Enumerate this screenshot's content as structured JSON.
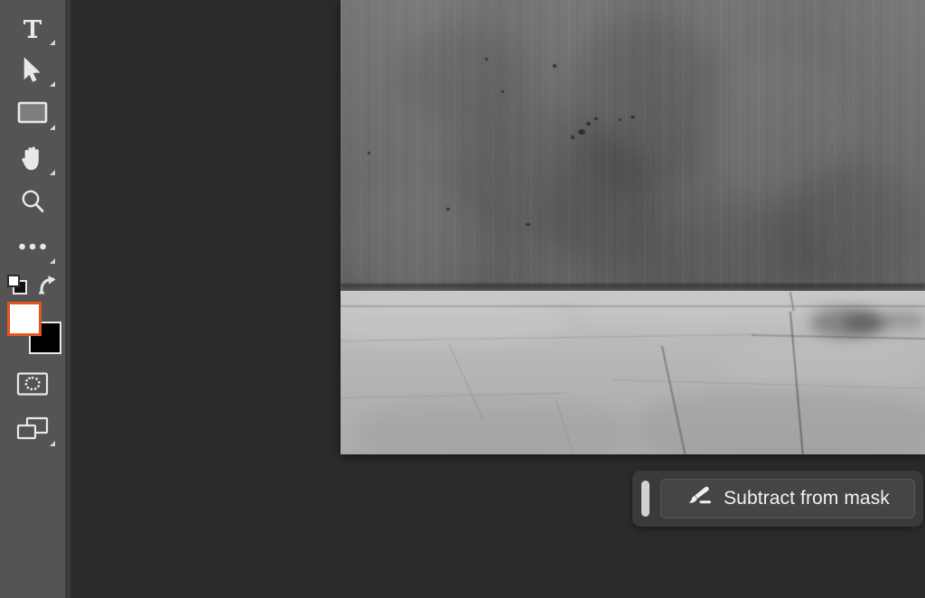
{
  "app": {
    "panel_bg": "#545454",
    "canvas_bg": "#2b2b2b",
    "accent": "#e2561f"
  },
  "toolbar": {
    "name": "tools-panel",
    "tools": [
      {
        "id": "type",
        "icon": "type-tool-icon",
        "label": "Type tool",
        "has_flyout": true,
        "selected": false
      },
      {
        "id": "select",
        "icon": "arrow-cursor-icon",
        "label": "Move / Select tool",
        "has_flyout": true,
        "selected": false
      },
      {
        "id": "crop",
        "icon": "rectangle-tool-icon",
        "label": "Crop tool",
        "has_flyout": true,
        "selected": false
      },
      {
        "id": "hand",
        "icon": "hand-tool-icon",
        "label": "Hand tool",
        "has_flyout": true,
        "selected": false
      },
      {
        "id": "zoom",
        "icon": "magnifier-tool-icon",
        "label": "Zoom tool",
        "has_flyout": false,
        "selected": false
      },
      {
        "id": "more",
        "icon": "ellipsis-icon",
        "label": "Edit toolbar",
        "has_flyout": true,
        "selected": false
      }
    ],
    "colors": {
      "foreground_label": "Foreground color",
      "foreground": "#ffffff",
      "background_label": "Background color",
      "background": "#000000",
      "default_colors_label": "Default foreground and background colors",
      "swap_label": "Switch foreground and background colors"
    },
    "modes": [
      {
        "id": "quickmask",
        "icon": "quick-mask-icon",
        "label": "Edit in Quick Mask Mode",
        "has_flyout": false
      },
      {
        "id": "screenmode",
        "icon": "screen-mode-icon",
        "label": "Change Screen Mode",
        "has_flyout": true
      }
    ]
  },
  "canvas": {
    "name": "image-canvas",
    "image_alt": "Grayscale photograph of a concrete wall above a paved stone sidewalk"
  },
  "tooltip_bar": {
    "name": "contextual-task-bar",
    "drag_handle_label": "Drag task bar",
    "action": {
      "icon": "brush-icon",
      "label": "Subtract from mask"
    }
  }
}
